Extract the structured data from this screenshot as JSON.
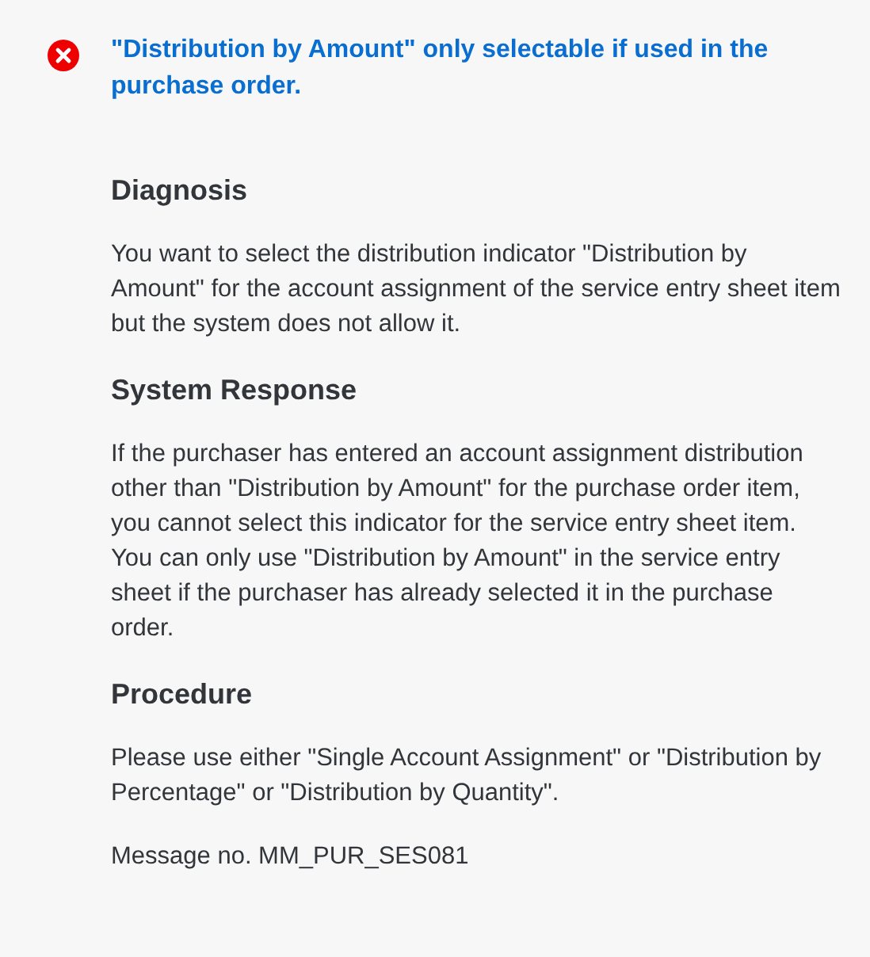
{
  "message": {
    "kind": "error",
    "title": "\"Distribution by Amount\" only selectable if used in the purchase order."
  },
  "sections": [
    {
      "heading": "Diagnosis",
      "text": "You want to select the distribution indicator \"Distribution by Amount\" for the account assignment of the service entry sheet item but the system does not allow it."
    },
    {
      "heading": "System Response",
      "text": "If the purchaser has entered an account assignment distribution other than \"Distribution by Amount\" for the purchase order item, you cannot select this indicator for the service entry sheet item. You can only use \"Distribution by Amount\" in the service entry sheet if the purchaser has already selected it in the purchase order."
    },
    {
      "heading": "Procedure",
      "text": "Please use either \"Single Account Assignment\" or \"Distribution by Percentage\" or \"Distribution by Quantity\"."
    }
  ],
  "message_number": "Message no. MM_PUR_SES081"
}
